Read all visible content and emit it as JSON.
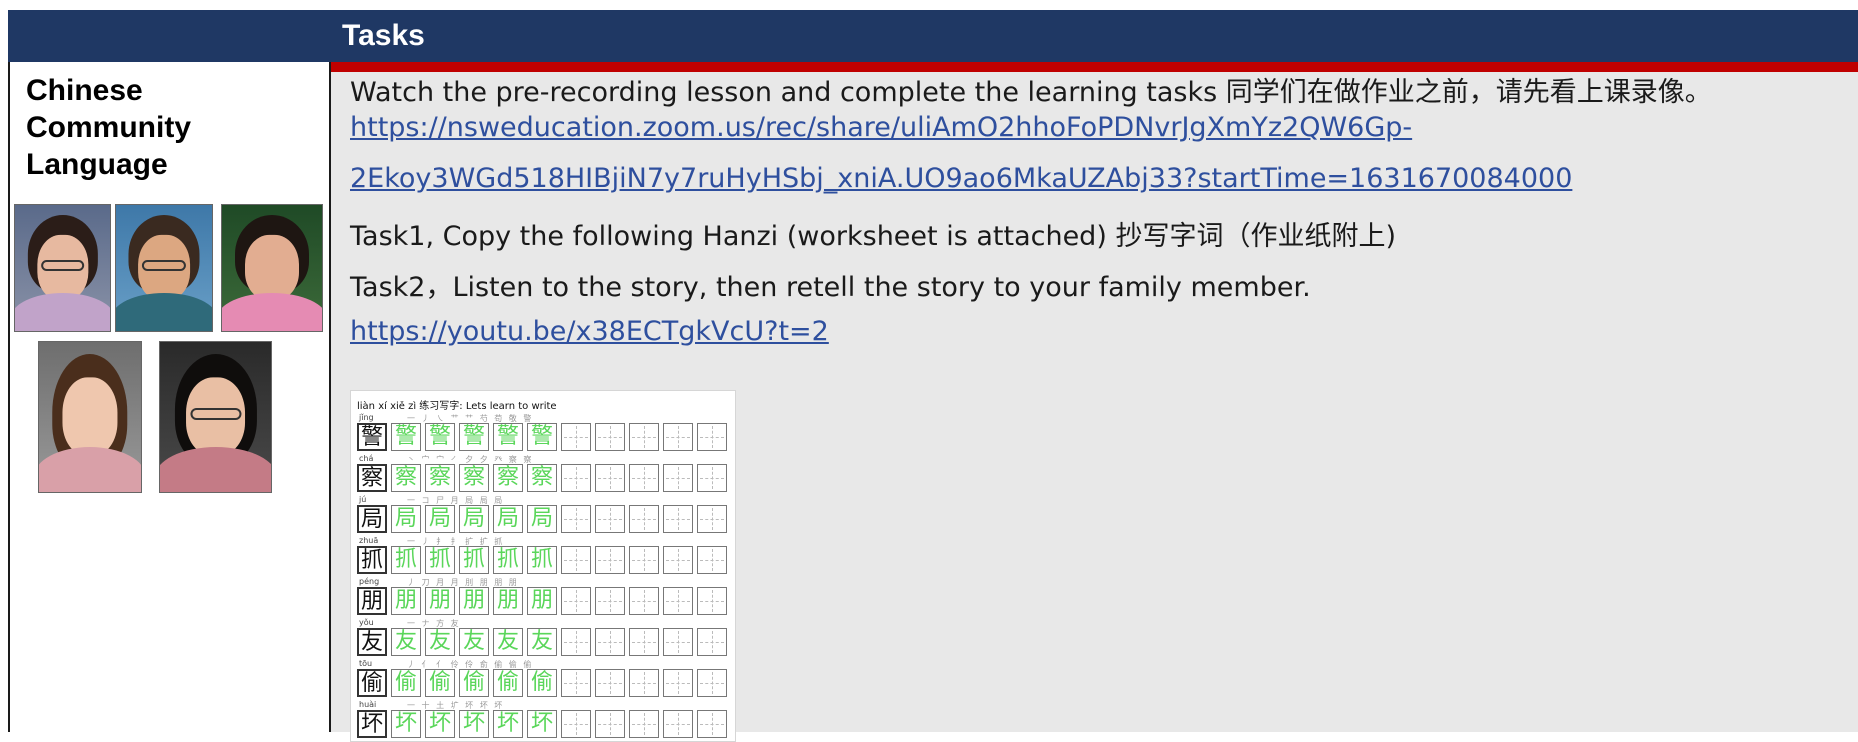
{
  "header": {
    "tasks_label": "Tasks"
  },
  "left": {
    "subject_line1": "Chinese",
    "subject_line2": "Community",
    "subject_line3": "Language"
  },
  "content": {
    "line1": "Watch the pre-recording lesson and complete the learning tasks 同学们在做作业之前，请先看上课录像。",
    "link1_part1": "https://nsweducation.zoom.us/rec/share/uliAmO2hhoFoPDNvrJgXmYz2QW6Gp-",
    "link1_part2": "2Ekoy3WGd518HIBjiN7y7ruHyHSbj_xniA.UO9ao6MkaUZAbj33?startTime=1631670084000",
    "task1": "Task1, Copy the following Hanzi (worksheet is attached) 抄写字词（作业纸附上)",
    "task2": "Task2，Listen to the story, then retell the story to your family member.",
    "link2": "https://youtu.be/x38ECTgkVcU?t=2"
  },
  "worksheet": {
    "title": "liàn xí xiě zì 练习写字: Lets learn to write",
    "rows": [
      {
        "pinyin": "jǐng",
        "char": "警",
        "strokes": "一 丿 ㇏ 艹 艹 芍 苟 敬 警"
      },
      {
        "pinyin": "chá",
        "char": "察",
        "strokes": "丶 宀 宀 ㇒ 夕 夕 癶 察 察"
      },
      {
        "pinyin": "jú",
        "char": "局",
        "strokes": "一 コ 尸 月 局 局 局"
      },
      {
        "pinyin": "zhuā",
        "char": "抓",
        "strokes": "一 丿 扌 扌 扩 扩 抓"
      },
      {
        "pinyin": "péng",
        "char": "朋",
        "strokes": "丿 刀 月 月 刖 朋 朋 朋"
      },
      {
        "pinyin": "yǒu",
        "char": "友",
        "strokes": "一 ナ 方 友"
      },
      {
        "pinyin": "tōu",
        "char": "偷",
        "strokes": "丿 亻 亻 伶 伶 俞 偷 偷 偷"
      },
      {
        "pinyin": "huài",
        "char": "坏",
        "strokes": "一 十 土 圹 坏 坏 坏"
      }
    ]
  },
  "colors": {
    "header_bg": "#1f3864",
    "accent_red": "#c00000",
    "link": "#2e4f9e",
    "content_bg": "#e8e8e8",
    "trace_green": "#5ad65a"
  }
}
